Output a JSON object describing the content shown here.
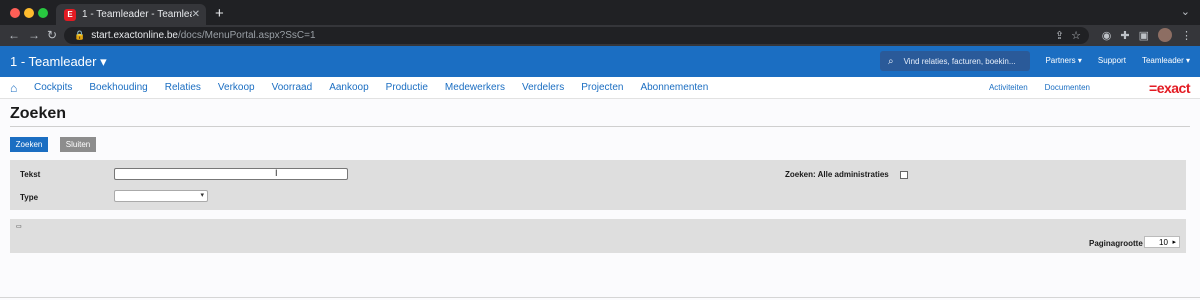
{
  "browser": {
    "tab_favicon": "E",
    "tab_title": "1 - Teamleader - Teamleader",
    "tab_close": "✕",
    "new_tab": "+",
    "url_host": "start.exactonline.be",
    "url_path": "/docs/MenuPortal.aspx?SsC=1",
    "traffic_lights": [
      "#ff5f57",
      "#febc2e",
      "#28c840"
    ]
  },
  "app": {
    "title": "1 - Teamleader ▾",
    "search_placeholder": "Vind relaties, facturen, boekin...",
    "links": [
      "Partners ▾",
      "Support",
      "Teamleader ▾"
    ]
  },
  "menu": {
    "items": [
      "Cockpits",
      "Boekhouding",
      "Relaties",
      "Verkoop",
      "Voorraad",
      "Aankoop",
      "Productie",
      "Medewerkers",
      "Verdelers",
      "Projecten",
      "Abonnementen"
    ],
    "right_links": [
      "Activiteiten",
      "Documenten"
    ],
    "logo": "=exact"
  },
  "page": {
    "title": "Zoeken",
    "search_button": "Zoeken",
    "close_button": "Sluiten",
    "text_label": "Tekst",
    "text_value": "",
    "type_label": "Type",
    "type_value": "",
    "all_admin_label": "Zoeken: Alle administraties",
    "all_admin_checked": false,
    "page_size_label": "Paginagrootte",
    "page_size_value": "10"
  },
  "colors": {
    "brand_blue": "#1b6ec2",
    "exact_red": "#e31b23",
    "panel_gray": "#dedede"
  }
}
